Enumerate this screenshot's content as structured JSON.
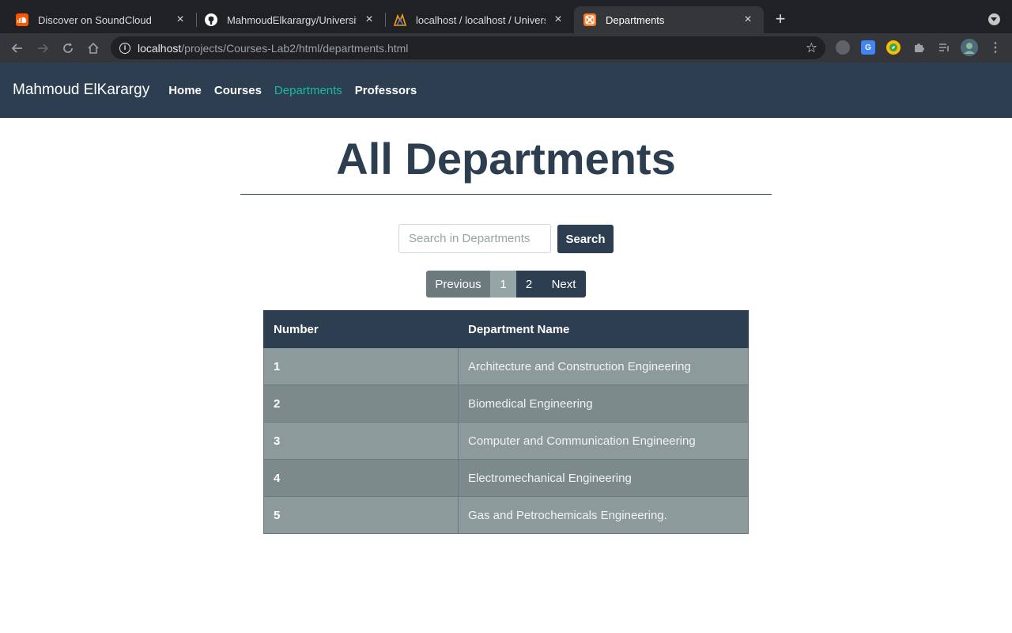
{
  "browser": {
    "tabs": [
      {
        "title": "Discover on SoundCloud",
        "icon": "soundcloud-icon",
        "color": "#ff5500"
      },
      {
        "title": "MahmoudElkarargy/University-",
        "icon": "github-icon",
        "color": "#ffffff"
      },
      {
        "title": "localhost / localhost / Universit",
        "icon": "phpmyadmin-icon",
        "color": "#f89c0e"
      },
      {
        "title": "Departments",
        "icon": "xampp-icon",
        "color": "#fb7a24"
      }
    ],
    "url_host": "localhost",
    "url_path": "/projects/Courses-Lab2/html/departments.html"
  },
  "navbar": {
    "brand": "Mahmoud ElKarargy",
    "links": [
      "Home",
      "Courses",
      "Departments",
      "Professors"
    ],
    "active_link": "Departments",
    "bg_color": "#2c3e50",
    "active_color": "#18bc9c"
  },
  "main": {
    "title": "All Departments",
    "search": {
      "placeholder": "Search in Departments",
      "button_label": "Search"
    },
    "pagination": {
      "previous": "Previous",
      "pages": [
        "1",
        "2"
      ],
      "current": "1",
      "next": "Next"
    },
    "table": {
      "headers": [
        "Number",
        "Department Name"
      ],
      "rows": [
        [
          "1",
          "Architecture and Construction Engineering"
        ],
        [
          "2",
          "Biomedical Engineering"
        ],
        [
          "3",
          "Computer and Communication Engineering"
        ],
        [
          "4",
          "Electromechanical Engineering"
        ],
        [
          "5",
          "Gas and Petrochemicals Engineering."
        ]
      ]
    }
  }
}
